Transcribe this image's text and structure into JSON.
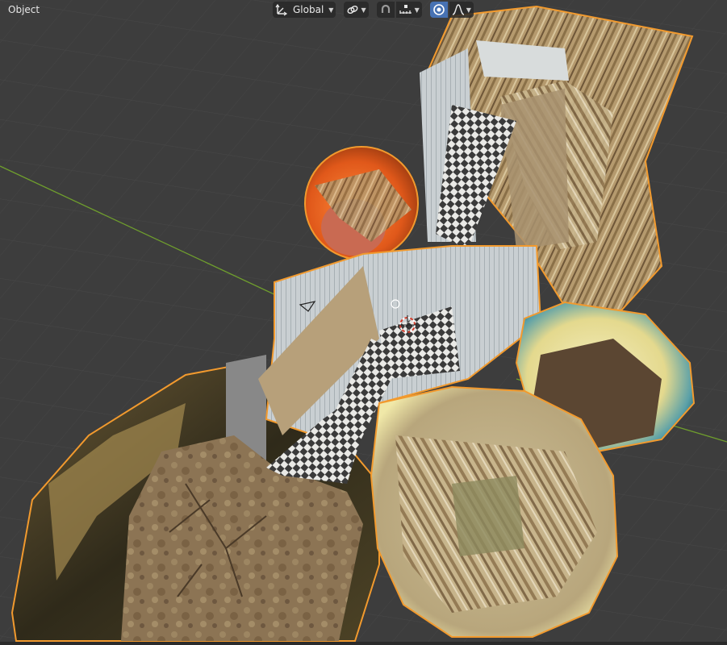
{
  "header": {
    "mode_label": "Object",
    "transform_orientation": {
      "label": "Global",
      "icon": "transform-orientation-icon"
    },
    "pivot_icon": "pivot-link-icon",
    "snap_icon": "snap-magnet-icon",
    "snap_target_icon": "snap-increment-icon",
    "proportional_icon": "proportional-editing-icon",
    "falloff_icon": "falloff-curve-icon"
  },
  "colors": {
    "grid_bg": "#3d3d3d",
    "grid_line": "#474747",
    "axis_x": "#c0453f",
    "axis_y": "#6f9e2d",
    "selection_outline": "#f29a2e",
    "active_button": "#4772b3"
  },
  "scene": {
    "objects": [
      "ruined-house-building",
      "foliage-dome-left",
      "orange-sphere",
      "sky-sphere-right",
      "debris-sphere-bottom",
      "dirt-ground-patch",
      "checker-floor"
    ]
  }
}
